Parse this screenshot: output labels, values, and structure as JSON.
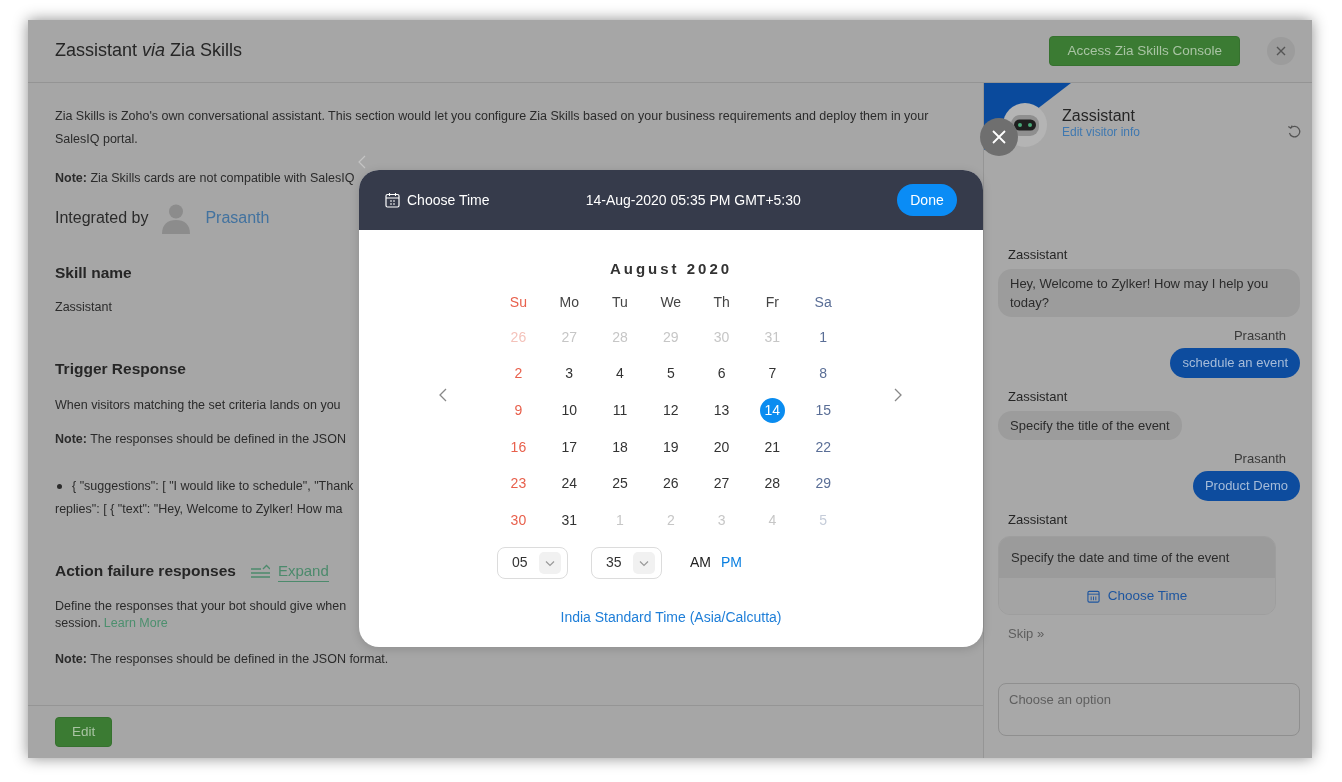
{
  "dialog": {
    "title": "Zassistant *via* Zia Skills",
    "console_button": "Access Zia Skills Console",
    "edit_button": "Edit"
  },
  "intro": "Zia Skills is Zoho's own conversational assistant. This section would let you configure Zia Skills based on your business requirements and deploy them in your SalesIQ portal.",
  "compatibility_note": "**Note:** Zia Skills cards are not compatible with SalesIQ",
  "integrated_by": {
    "label": "Integrated by",
    "name": "Prasanth"
  },
  "skill_name": {
    "heading": "Skill name",
    "value": "Zassistant"
  },
  "trigger_response": {
    "heading": "Trigger Response",
    "description": "When visitors matching the set criteria lands on you",
    "note": "**Note:** The responses should be defined in the JSON",
    "code_lines": [
      "{ \"suggestions\": [ \"I would like to schedule\", \"Thank",
      "replies\": [ { \"text\": \"Hey, Welcome to Zylker! How ma"
    ]
  },
  "action_failure": {
    "heading": "Action failure responses",
    "expand_link": "Expand",
    "description_lines": [
      "Define the responses that your bot should give when",
      "session."
    ],
    "learn_more": "Learn More",
    "note": "**Note:** The responses should be defined in the JSON format."
  },
  "chat": {
    "bot_name": "Zassistant",
    "edit_link": "Edit visitor info",
    "messages": [
      {
        "kind": "bot",
        "sender": "Zassistant",
        "text": "Hey, Welcome to Zylker! How may I help you today?"
      },
      {
        "kind": "visitor",
        "sender": "Prasanth",
        "text": "schedule an event"
      },
      {
        "kind": "bot",
        "sender": "Zassistant",
        "text": "Specify the title of the event"
      },
      {
        "kind": "visitor",
        "sender": "Prasanth",
        "text": "Product Demo"
      },
      {
        "kind": "card",
        "sender": "Zassistant",
        "text": "Specify the date and time of the event",
        "action": "Choose Time"
      }
    ],
    "skip": "Skip »",
    "input": {
      "placeholder": "Choose an option"
    }
  },
  "time_picker": {
    "title": "Choose Time",
    "summary": "14-Aug-2020 05:35 PM GMT+5:30",
    "done_button": "Done",
    "month": "August 2020",
    "weekdays": [
      "Su",
      "Mo",
      "Tu",
      "We",
      "Th",
      "Fr",
      "Sa"
    ],
    "days": [
      {
        "label": "26",
        "outside": true,
        "selected": false
      },
      {
        "label": "27",
        "outside": true,
        "selected": false
      },
      {
        "label": "28",
        "outside": true,
        "selected": false
      },
      {
        "label": "29",
        "outside": true,
        "selected": false
      },
      {
        "label": "30",
        "outside": true,
        "selected": false
      },
      {
        "label": "31",
        "outside": true,
        "selected": false
      },
      {
        "label": "1",
        "outside": false,
        "selected": false
      },
      {
        "label": "2",
        "outside": false,
        "selected": false
      },
      {
        "label": "3",
        "outside": false,
        "selected": false
      },
      {
        "label": "4",
        "outside": false,
        "selected": false
      },
      {
        "label": "5",
        "outside": false,
        "selected": false
      },
      {
        "label": "6",
        "outside": false,
        "selected": false
      },
      {
        "label": "7",
        "outside": false,
        "selected": false
      },
      {
        "label": "8",
        "outside": false,
        "selected": false
      },
      {
        "label": "9",
        "outside": false,
        "selected": false
      },
      {
        "label": "10",
        "outside": false,
        "selected": false
      },
      {
        "label": "11",
        "outside": false,
        "selected": false
      },
      {
        "label": "12",
        "outside": false,
        "selected": false
      },
      {
        "label": "13",
        "outside": false,
        "selected": false
      },
      {
        "label": "14",
        "outside": false,
        "selected": true
      },
      {
        "label": "15",
        "outside": false,
        "selected": false
      },
      {
        "label": "16",
        "outside": false,
        "selected": false
      },
      {
        "label": "17",
        "outside": false,
        "selected": false
      },
      {
        "label": "18",
        "outside": false,
        "selected": false
      },
      {
        "label": "19",
        "outside": false,
        "selected": false
      },
      {
        "label": "20",
        "outside": false,
        "selected": false
      },
      {
        "label": "21",
        "outside": false,
        "selected": false
      },
      {
        "label": "22",
        "outside": false,
        "selected": false
      },
      {
        "label": "23",
        "outside": false,
        "selected": false
      },
      {
        "label": "24",
        "outside": false,
        "selected": false
      },
      {
        "label": "25",
        "outside": false,
        "selected": false
      },
      {
        "label": "26",
        "outside": false,
        "selected": false
      },
      {
        "label": "27",
        "outside": false,
        "selected": false
      },
      {
        "label": "28",
        "outside": false,
        "selected": false
      },
      {
        "label": "29",
        "outside": false,
        "selected": false
      },
      {
        "label": "30",
        "outside": false,
        "selected": false
      },
      {
        "label": "31",
        "outside": false,
        "selected": false
      },
      {
        "label": "1",
        "outside": true,
        "selected": false
      },
      {
        "label": "2",
        "outside": true,
        "selected": false
      },
      {
        "label": "3",
        "outside": true,
        "selected": false
      },
      {
        "label": "4",
        "outside": true,
        "selected": false
      },
      {
        "label": "5",
        "outside": true,
        "selected": false
      }
    ],
    "hour": "05",
    "minute": "35",
    "periods": [
      {
        "label": "AM",
        "selected": false
      },
      {
        "label": "PM",
        "selected": true
      }
    ],
    "timezone": "India Standard Time (Asia/Calcutta)"
  }
}
